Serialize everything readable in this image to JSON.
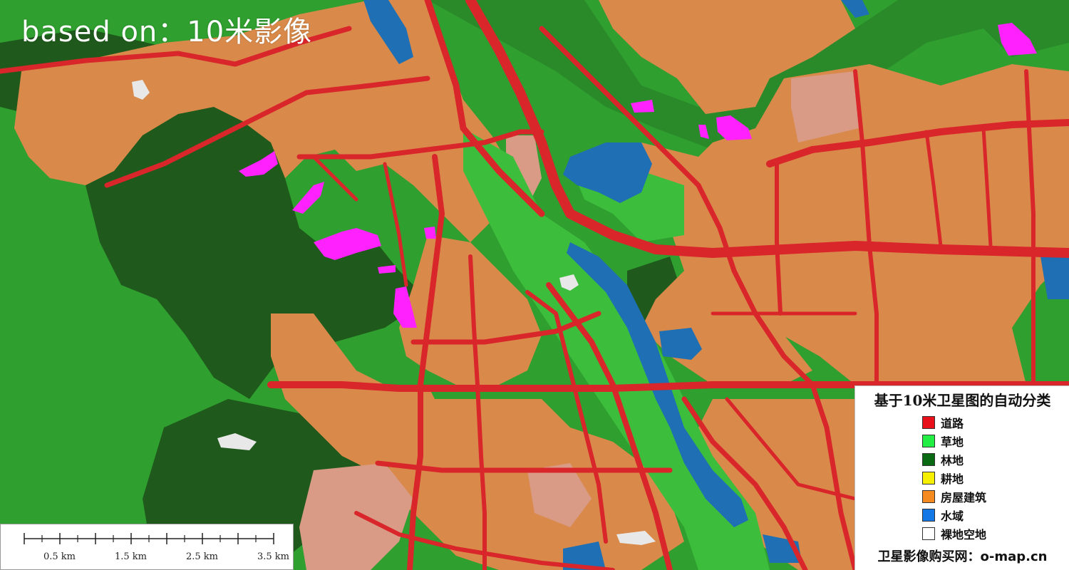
{
  "overlay": {
    "title": "based on：10米影像"
  },
  "scale_bar": {
    "labels": [
      "0.5 km",
      "1.5 km",
      "2.5 km",
      "3.5 km"
    ]
  },
  "legend": {
    "title": "基于10米卫星图的自动分类",
    "items": [
      {
        "label": "道路",
        "color": "#e8101a"
      },
      {
        "label": "草地",
        "color": "#22ee44"
      },
      {
        "label": "林地",
        "color": "#0a6a14"
      },
      {
        "label": "耕地",
        "color": "#f6f000"
      },
      {
        "label": "房屋建筑",
        "color": "#f48a20"
      },
      {
        "label": "水域",
        "color": "#1477e6"
      },
      {
        "label": "裸地空地",
        "color": "#ffffff"
      }
    ],
    "footer": "卫星影像购买网：o-map.cn"
  },
  "colors": {
    "forest_dark": "#1f5a1c",
    "grass": "#33aa33",
    "building": "#d98a4a",
    "road": "#d9262b",
    "water": "#1e6fb4",
    "magenta": "#ff22ff",
    "bare": "#e8e8e8",
    "light_building": "#d99a86"
  }
}
